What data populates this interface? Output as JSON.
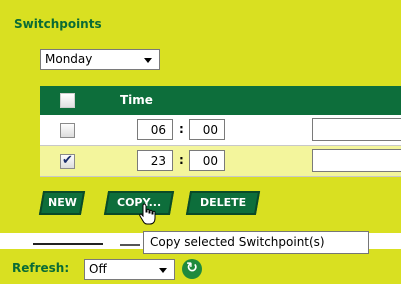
{
  "panel": {
    "title": "Switchpoints"
  },
  "day_select": {
    "value": "Monday"
  },
  "grid": {
    "header": {
      "time_label": "Time",
      "select_all_checked": false
    },
    "rows": [
      {
        "checked": false,
        "hour": "06",
        "minute": "00",
        "colon": ":"
      },
      {
        "checked": true,
        "hour": "23",
        "minute": "00",
        "colon": ":"
      }
    ]
  },
  "buttons": {
    "new": "NEW",
    "copy": "COPY...",
    "delete": "DELETE"
  },
  "tooltip": {
    "text": "Copy selected Switchpoint(s)"
  },
  "refresh": {
    "label": "Refresh:",
    "value": "Off",
    "icon": "refresh-icon"
  },
  "colors": {
    "panel_bg": "#d9e021",
    "header_bg": "#0d6e3b",
    "selected_row_bg": "#f3f59c",
    "accent_text": "#0a6b35"
  }
}
